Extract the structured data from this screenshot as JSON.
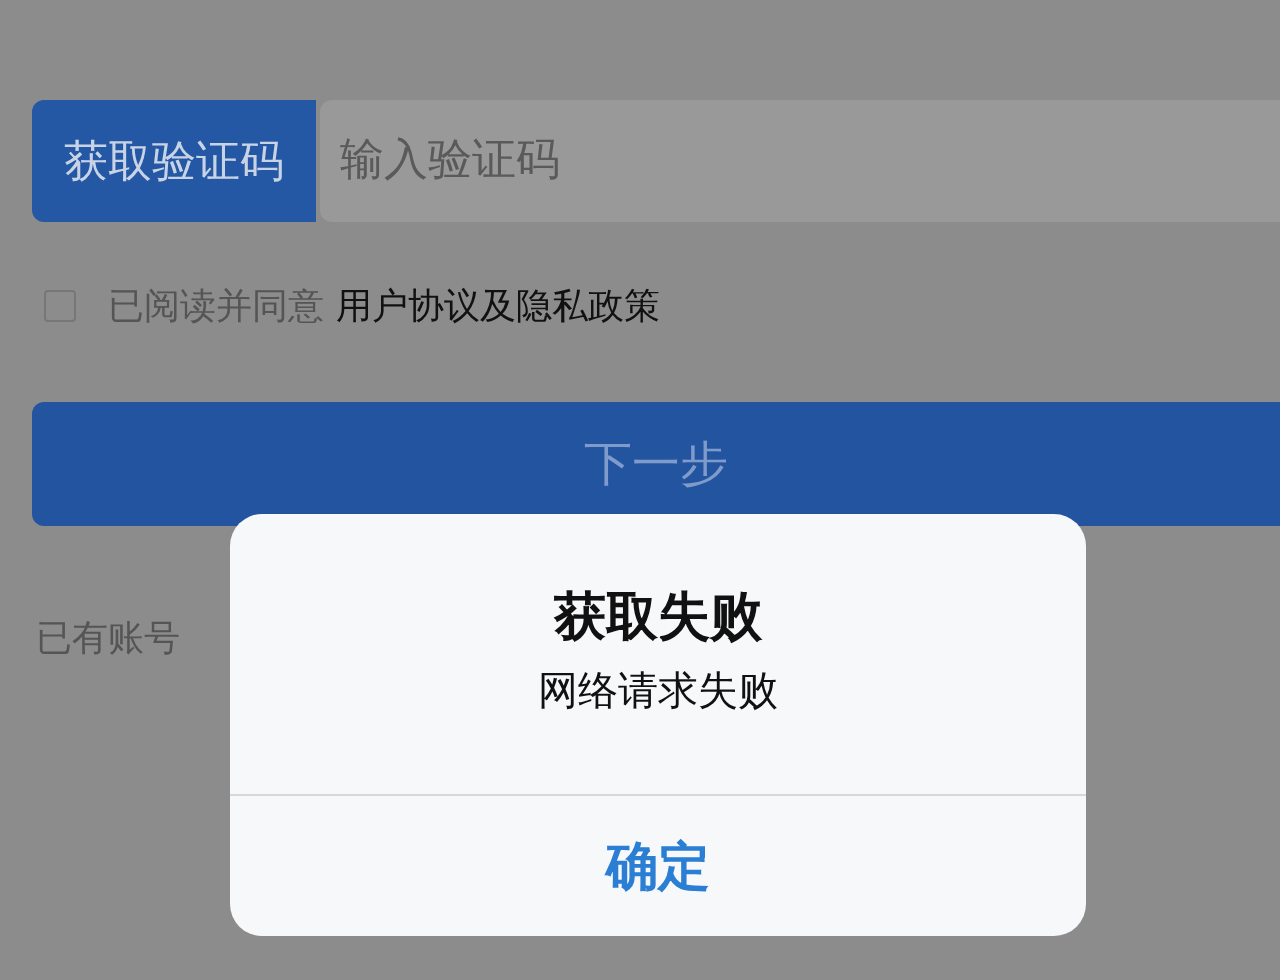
{
  "form": {
    "code_button": "获取验证码",
    "code_field": {
      "placeholder": "输入验证码"
    },
    "agreement": {
      "checked": false,
      "prefix": "已阅读并同意",
      "link": "用户协议及隐私政策"
    },
    "next_button": "下一步",
    "login_hint": "已有账号"
  },
  "alert": {
    "title": "获取失败",
    "message": "网络请求失败",
    "buttons": [
      "确定"
    ]
  }
}
